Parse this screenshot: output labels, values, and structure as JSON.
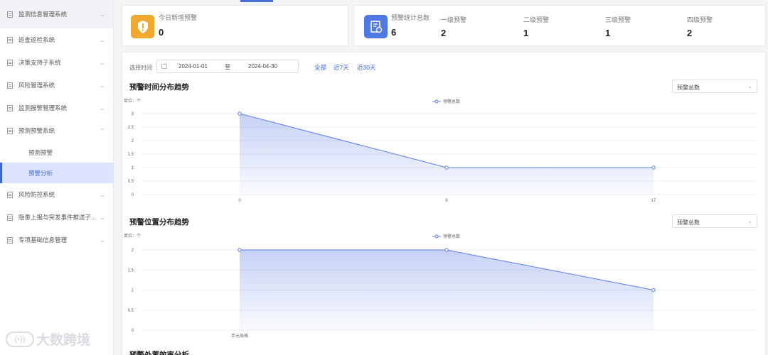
{
  "sidebar": {
    "items": [
      {
        "label": "监测信息管理系统",
        "chevron": "⌄"
      },
      {
        "label": "巡查巡检系统",
        "chevron": "⌄"
      },
      {
        "label": "决策支持子系统",
        "chevron": "⌄"
      },
      {
        "label": "风险管理系统",
        "chevron": "⌄"
      },
      {
        "label": "监测报警管理系统",
        "chevron": "⌄"
      },
      {
        "label": "预测预警系统",
        "chevron": "⌃"
      },
      {
        "label": "风险防控系统",
        "chevron": "⌄"
      },
      {
        "label": "隐患上报与突发事件推送子...",
        "chevron": "⌄"
      },
      {
        "label": "专项基础信息管理",
        "chevron": "⌄"
      }
    ],
    "sub_items": [
      {
        "label": "预测预警"
      },
      {
        "label": "预警分析"
      }
    ]
  },
  "watermark": {
    "badge": "(•))",
    "text": "大数跨境"
  },
  "today_card": {
    "label": "今日新增预警",
    "value": "0",
    "icon": "alert-icon",
    "color": "#f0a92e"
  },
  "total_card": {
    "label": "预警统计总数",
    "value": "6",
    "icon": "report-icon",
    "color": "#4f79e0",
    "levels": [
      {
        "label": "一级预警",
        "value": "2"
      },
      {
        "label": "二级预警",
        "value": "1"
      },
      {
        "label": "三级预警",
        "value": "1"
      },
      {
        "label": "四级预警",
        "value": "2"
      }
    ]
  },
  "filter": {
    "label": "选择时间",
    "start": "2024-01-01",
    "separator": "至",
    "end": "2024-04-30",
    "quick": [
      "全部",
      "近7天",
      "近30天"
    ]
  },
  "sections": [
    {
      "title": "预警时间分布趋势",
      "select": "预警总数"
    },
    {
      "title": "预警位置分布趋势",
      "select": "预警总数"
    },
    {
      "title": "预警处置效率分析"
    }
  ],
  "chart_data": [
    {
      "type": "area",
      "unit_label": "单位：个",
      "legend": "预警总数",
      "x": [
        "0",
        "8",
        "17"
      ],
      "series": [
        {
          "name": "预警总数",
          "values": [
            3,
            1,
            1
          ]
        }
      ],
      "yticks": [
        "0",
        "0.5",
        "1",
        "1.5",
        "2",
        "2.5",
        "3"
      ],
      "ylim": [
        0,
        3
      ],
      "color": "#5b7ce3"
    },
    {
      "type": "area",
      "unit_label": "单位：个",
      "legend": "预警总数",
      "x": [
        "手元局格",
        "",
        ""
      ],
      "series": [
        {
          "name": "预警总数",
          "values": [
            2,
            2,
            1
          ]
        }
      ],
      "yticks": [
        "0",
        "0.5",
        "1",
        "1.5",
        "2"
      ],
      "ylim": [
        0,
        2
      ],
      "color": "#5b7ce3"
    }
  ]
}
